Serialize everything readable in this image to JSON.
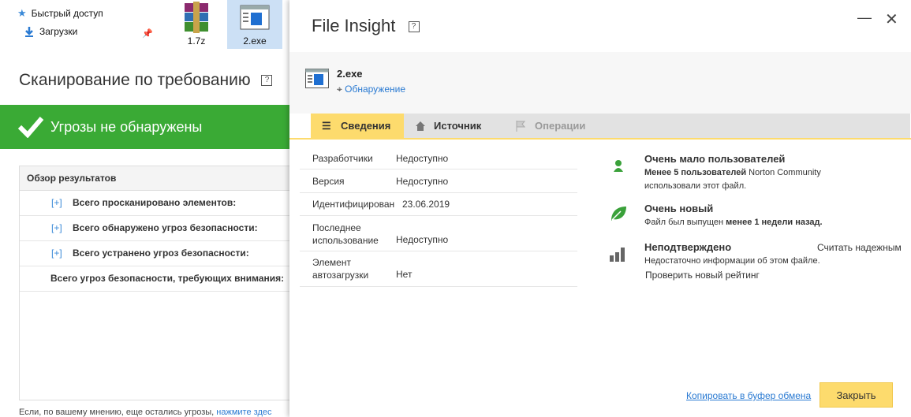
{
  "explorer": {
    "nav": [
      {
        "label": "Быстрый доступ",
        "icon": "star-icon"
      },
      {
        "label": "Загрузки",
        "icon": "download-arrow-icon"
      }
    ],
    "files": [
      {
        "label": "1.7z",
        "icon": "winrar-archive-icon",
        "selected": false
      },
      {
        "label": "2.exe",
        "icon": "exe-window-icon",
        "selected": true
      }
    ]
  },
  "scan": {
    "title": "Сканирование по требованию",
    "help": "?",
    "status": "Угрозы не обнаружены",
    "results_header": "Обзор результатов",
    "rows": [
      {
        "expander": "[+]",
        "label": "Всего просканировано элементов:"
      },
      {
        "expander": "[+]",
        "label": "Всего обнаружено угроз безопасности:"
      },
      {
        "expander": "[+]",
        "label": "Всего устранено угроз безопасности:"
      },
      {
        "expander": "",
        "label": "Всего угроз безопасности, требующих внимания:"
      }
    ],
    "note_text": "Если, по вашему мнению, еще остались угрозы,",
    "note_link": "нажмите здес"
  },
  "dialog": {
    "title": "File Insight",
    "help": "?",
    "file_name": "2.exe",
    "detection_link": "Обнаружение",
    "tabs": [
      {
        "label": "Сведения",
        "icon": "list-icon",
        "state": "active"
      },
      {
        "label": "Источник",
        "icon": "home-icon",
        "state": "normal"
      },
      {
        "label": "Операции",
        "icon": "flag-icon",
        "state": "disabled"
      }
    ],
    "properties": [
      {
        "key": "Разработчики",
        "value": "Недоступно"
      },
      {
        "key": "Версия",
        "value": "Недоступно"
      },
      {
        "key": "Идентифицирован",
        "value": "23.06.2019"
      },
      {
        "key": "Последнее использование",
        "value": "Недоступно"
      },
      {
        "key": "Элемент автозагрузки",
        "value": "Нет"
      }
    ],
    "stats": [
      {
        "icon": "person-icon",
        "title": "Очень мало пользователей",
        "line1_bold": "Менее 5 пользователей",
        "line1_rest": " Norton Community",
        "line2": "использовали этот файл.",
        "color": "#3aa13a"
      },
      {
        "icon": "leaf-icon",
        "title": "Очень новый",
        "line1_rest": "Файл был выпущен ",
        "line1_bold": "менее 1 недели назад.",
        "color": "#3aa13a"
      },
      {
        "icon": "bar-chart-icon",
        "title": "Неподтверждено",
        "action": "Считать надежным",
        "line1_rest": "Недостаточно информации об этом файле.",
        "link": "Проверить новый рейтинг",
        "color": "#666666"
      }
    ],
    "copy_link": "Копировать в буфер обмена",
    "close_button": "Закрыть"
  }
}
